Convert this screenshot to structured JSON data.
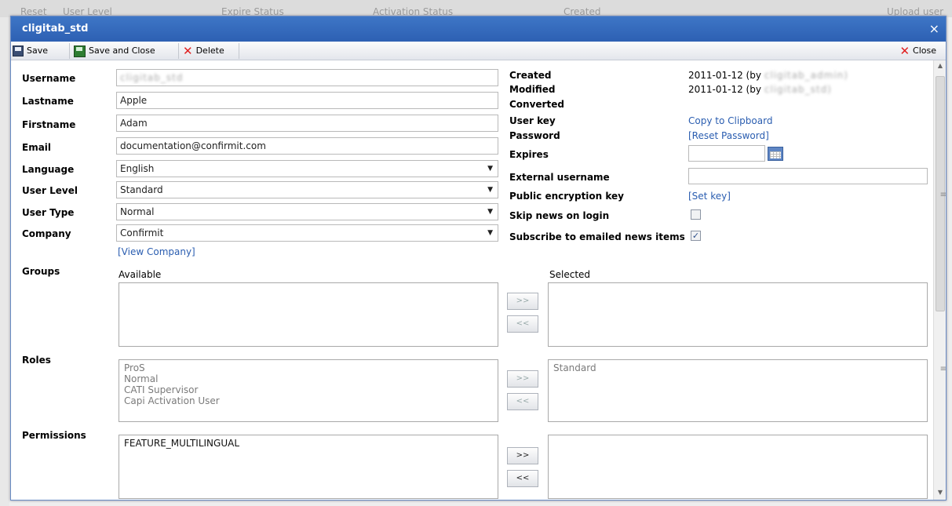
{
  "background": {
    "columns": [
      "Reset",
      "User Level",
      "Expire Status",
      "Activation Status",
      "Created",
      "Upload user"
    ]
  },
  "dialog": {
    "title": "cligitab_std",
    "close_glyph": "×"
  },
  "toolbar": {
    "save_label": "Save",
    "save_close_label": "Save and Close",
    "delete_label": "Delete",
    "close_label": "Close"
  },
  "form": {
    "username": {
      "label": "Username",
      "value": "cligitab_std"
    },
    "lastname": {
      "label": "Lastname",
      "value": "Apple"
    },
    "firstname": {
      "label": "Firstname",
      "value": "Adam"
    },
    "email": {
      "label": "Email",
      "value": "documentation@confirmit.com"
    },
    "language": {
      "label": "Language",
      "value": "English"
    },
    "user_level": {
      "label": "User Level",
      "value": "Standard"
    },
    "user_type": {
      "label": "User Type",
      "value": "Normal"
    },
    "company": {
      "label": "Company",
      "value": "Confirmit"
    },
    "view_company_link": "[View Company]"
  },
  "info": {
    "created": {
      "label": "Created",
      "value": "2011-01-12 (by ",
      "value_blur": "cligitab_admin)"
    },
    "modified": {
      "label": "Modified",
      "value": "2011-01-12 (by ",
      "value_blur": "cligitab_std)"
    },
    "converted": {
      "label": "Converted"
    },
    "user_key": {
      "label": "User key",
      "link": "Copy to Clipboard"
    },
    "password": {
      "label": "Password",
      "link": "[Reset Password]"
    },
    "expires": {
      "label": "Expires",
      "value": ""
    },
    "external_username": {
      "label": "External username",
      "value": ""
    },
    "public_key": {
      "label": "Public encryption key",
      "link": "[Set key]"
    },
    "skip_news": {
      "label": "Skip news on login",
      "checked": false
    },
    "subscribe_news": {
      "label": "Subscribe to emailed news items",
      "checked": true
    }
  },
  "groups": {
    "label": "Groups",
    "available_label": "Available",
    "selected_label": "Selected",
    "available": [],
    "selected": []
  },
  "roles": {
    "label": "Roles",
    "available": [
      "ProS",
      "Normal",
      "CATI Supervisor",
      "Capi Activation User"
    ],
    "selected": [
      "Standard"
    ]
  },
  "permissions": {
    "label": "Permissions",
    "available": [
      "FEATURE_MULTILINGUAL"
    ],
    "selected": []
  },
  "move": {
    "add": ">>",
    "remove": "<<"
  }
}
